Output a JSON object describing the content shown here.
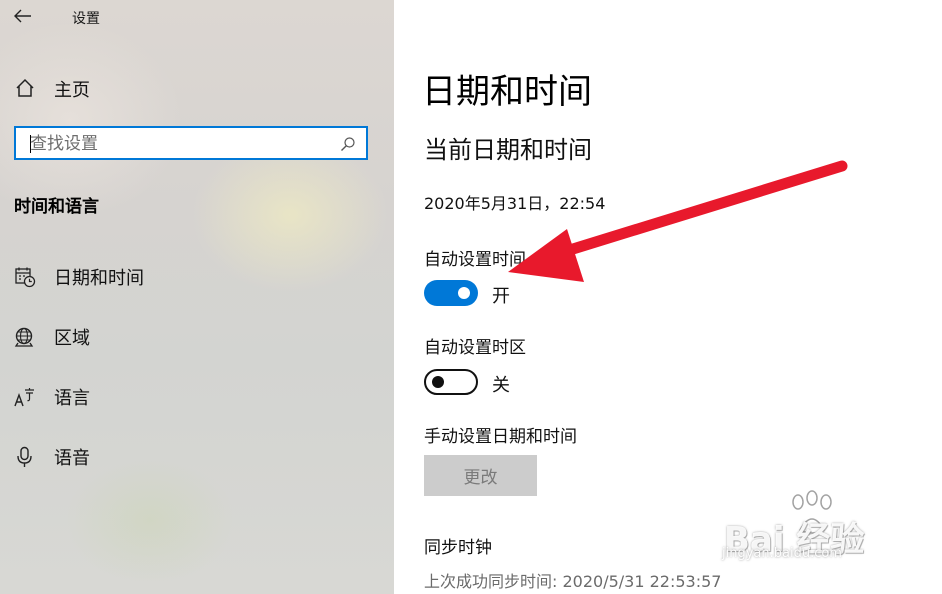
{
  "window": {
    "title": "设置"
  },
  "sidebar": {
    "home_label": "主页",
    "search": {
      "placeholder": "查找设置",
      "value": ""
    },
    "section_title": "时间和语言",
    "items": [
      {
        "label": "日期和时间",
        "icon": "calendar-clock-icon"
      },
      {
        "label": "区域",
        "icon": "globe-icon"
      },
      {
        "label": "语言",
        "icon": "language-icon"
      },
      {
        "label": "语音",
        "icon": "microphone-icon"
      }
    ]
  },
  "main": {
    "title": "日期和时间",
    "subtitle": "当前日期和时间",
    "current_datetime": "2020年5月31日，22:54",
    "auto_time": {
      "label": "自动设置时间",
      "state": "开",
      "on": true
    },
    "auto_timezone": {
      "label": "自动设置时区",
      "state": "关",
      "on": false
    },
    "manual": {
      "label": "手动设置日期和时间",
      "button": "更改"
    },
    "sync": {
      "label": "同步时钟",
      "last_sync": "上次成功同步时间: 2020/5/31 22:53:57"
    }
  },
  "watermark": {
    "brand": "Bai 经验",
    "site": "jingyan.baidu.com"
  },
  "colors": {
    "accent": "#0078d7",
    "annotation": "#e8192c",
    "disabled_button": "#cccccc"
  }
}
